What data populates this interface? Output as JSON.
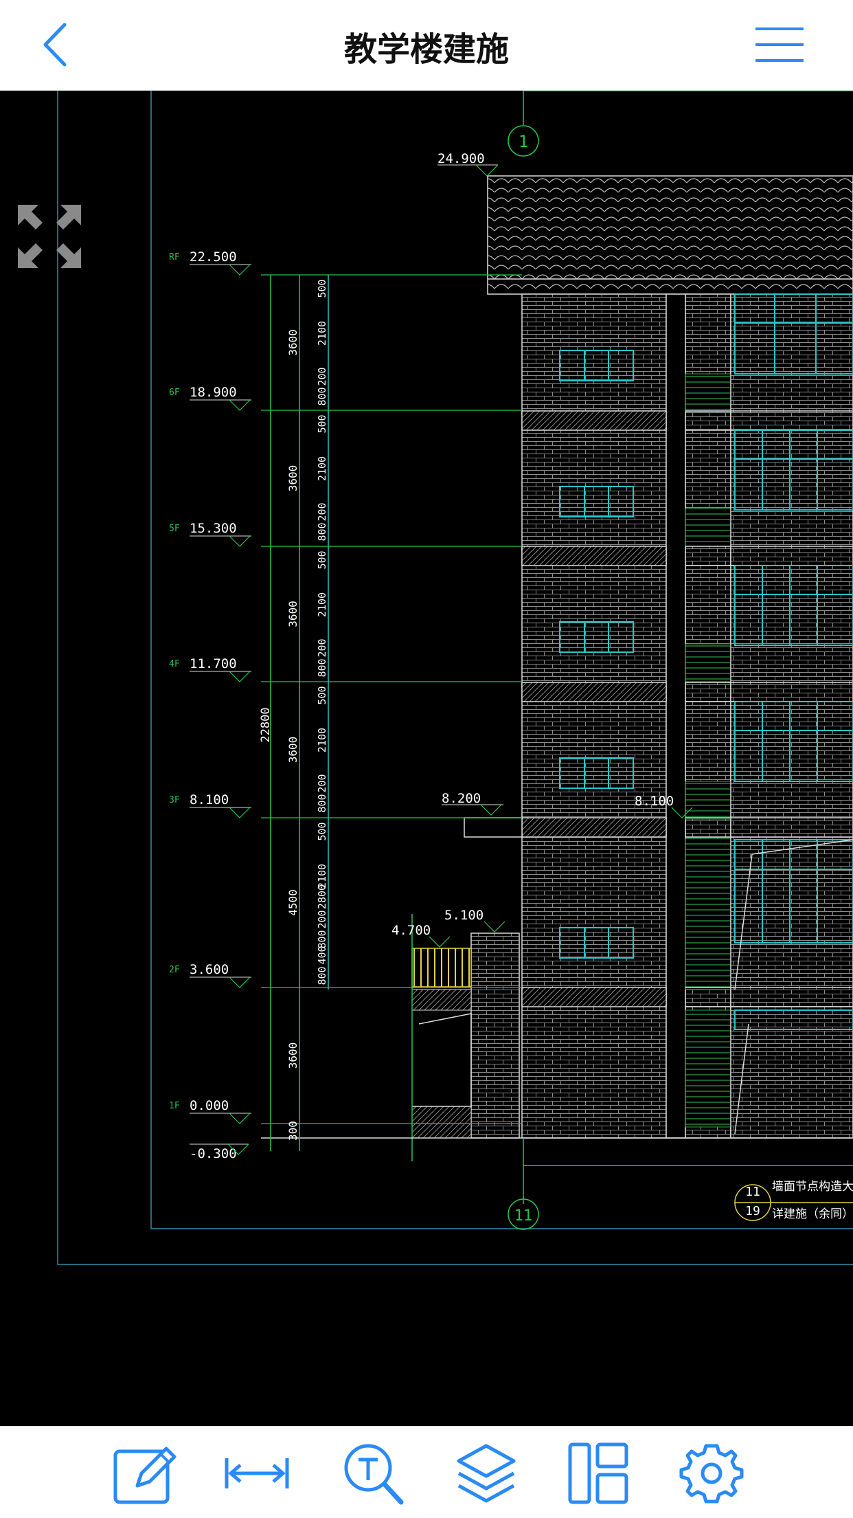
{
  "header": {
    "title": "教学楼建施",
    "back_icon": "chevron-left-icon",
    "menu_icon": "hamburger-menu-icon",
    "accent_color": "#2a8af6"
  },
  "drawing": {
    "background_color": "#000000",
    "grid_axis_top": "1",
    "grid_axis_bottom": "11",
    "roof_elevation": "24.900",
    "levels": [
      {
        "tag": "RF",
        "elevation": "22.500"
      },
      {
        "tag": "6F",
        "elevation": "18.900"
      },
      {
        "tag": "5F",
        "elevation": "15.300"
      },
      {
        "tag": "4F",
        "elevation": "11.700"
      },
      {
        "tag": "3F",
        "elevation": "8.100"
      },
      {
        "tag": "2F",
        "elevation": "3.600"
      },
      {
        "tag": "1F",
        "elevation": "0.000"
      }
    ],
    "ground_elevation": "-0.300",
    "canopy_elevation": "8.200",
    "canopy_elevation_right": "8.100",
    "low_wall_elevation_a": "4.700",
    "low_wall_elevation_b": "5.100",
    "total_height_dim": "22800",
    "story_dims": [
      "3600",
      "3600",
      "3600",
      "3600",
      "4500",
      "3600",
      "300"
    ],
    "sub_dims_top": [
      "500",
      "2100",
      "200",
      "800"
    ],
    "sub_dims_2f": [
      "2800",
      "400",
      "800"
    ],
    "detail_ref_top": "11",
    "detail_ref_bottom": "19",
    "detail_note_line1": "墙面节点构造大样",
    "detail_note_line2": "详建施（余同）"
  },
  "toolbar": {
    "tools": [
      {
        "name": "annotate",
        "icon": "pencil-edit-icon"
      },
      {
        "name": "measure",
        "icon": "distance-measure-icon"
      },
      {
        "name": "text-search",
        "icon": "text-search-icon"
      },
      {
        "name": "layers",
        "icon": "layers-icon"
      },
      {
        "name": "layout",
        "icon": "layout-panels-icon"
      },
      {
        "name": "settings",
        "icon": "gear-icon"
      }
    ]
  }
}
